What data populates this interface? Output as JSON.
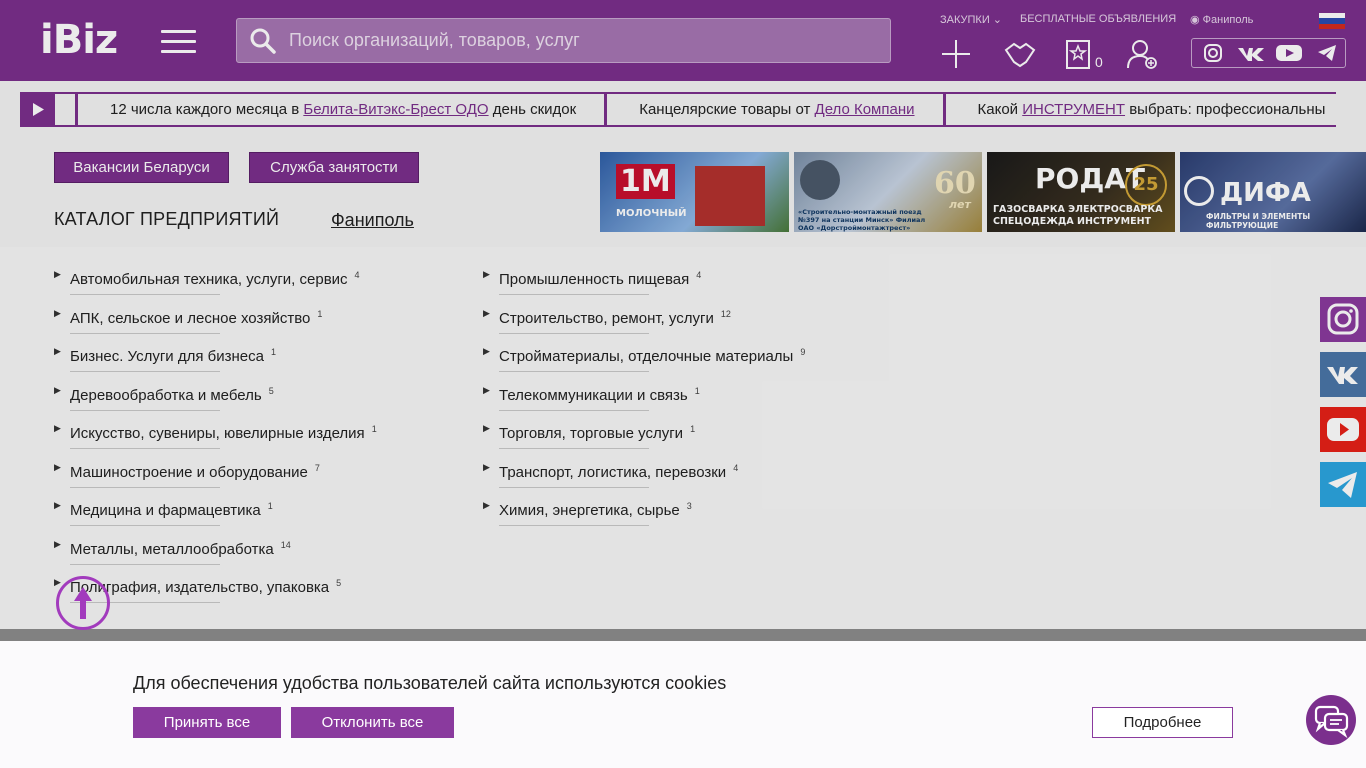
{
  "header": {
    "logo": "iBiz",
    "search_placeholder": "Поиск организаций, товаров, услуг",
    "links": {
      "zakupki": "ЗАКУПКИ",
      "free_ads": "БЕСПЛАТНЫЕ ОБЪЯВЛЕНИЯ",
      "location": "Фаниполь"
    },
    "favorites_count": "0",
    "icons": [
      "plus-icon",
      "handshake-icon",
      "star-icon",
      "user-add-icon"
    ],
    "social": [
      "instagram-icon",
      "vk-icon",
      "youtube-icon",
      "telegram-icon"
    ]
  },
  "ticker": [
    {
      "pre": "12 числа каждого месяца в ",
      "link": "Белита-Витэкс-Брест ОДО",
      "post": " день скидок"
    },
    {
      "pre": "Канцелярские товары от ",
      "link": "Дело Компани",
      "post": ""
    },
    {
      "pre": "Какой ",
      "link": "ИНСТРУМЕНТ",
      "post": " выбрать: профессиональны"
    }
  ],
  "buttons": {
    "vacancies": "Вакансии Беларуси",
    "employment": "Служба занятости"
  },
  "catalog": {
    "title": "КАТАЛОГ ПРЕДПРИЯТИЙ",
    "city": "Фаниполь",
    "col1": [
      {
        "label": "Автомобильная техника, услуги, сервис",
        "count": "4"
      },
      {
        "label": "АПК, сельское и лесное хозяйство",
        "count": "1"
      },
      {
        "label": "Бизнес. Услуги для бизнеса",
        "count": "1"
      },
      {
        "label": "Деревообработка и мебель",
        "count": "5"
      },
      {
        "label": "Искусство, сувениры, ювелирные изделия",
        "count": "1"
      },
      {
        "label": "Машиностроение и оборудование",
        "count": "7"
      },
      {
        "label": "Медицина и фармацевтика",
        "count": "1"
      },
      {
        "label": "Металлы, металлообработка",
        "count": "14"
      },
      {
        "label": "Полиграфия, издательство, упаковка",
        "count": "5"
      }
    ],
    "col2": [
      {
        "label": "Промышленность пищевая",
        "count": "4"
      },
      {
        "label": "Строительство, ремонт, услуги",
        "count": "12"
      },
      {
        "label": "Стройматериалы, отделочные материалы",
        "count": "9"
      },
      {
        "label": "Телекоммуникации и связь",
        "count": "1"
      },
      {
        "label": "Торговля, торговые услуги",
        "count": "1"
      },
      {
        "label": "Транспорт, логистика, перевозки",
        "count": "4"
      },
      {
        "label": "Химия, энергетика, сырье",
        "count": "3"
      }
    ]
  },
  "banners": {
    "b1": "1М",
    "b1_sub": "МОЛОЧНЫЙ",
    "b2": "60",
    "b2_sub": "«Строительно-монтажный поезд №397 на станции Минск» Филиал ОАО «Дорстроймонтажтрест»",
    "b2_sub2": "лет",
    "b3": "РОДАТ",
    "b3_sub": "ГАЗОСВАРКА  ЭЛЕКТРОСВАРКА",
    "b3_sub2": "СПЕЦОДЕЖДА  ИНСТРУМЕНТ",
    "b3_years": "25",
    "b4": "ДИФА",
    "b4_sub": "ФИЛЬТРЫ И ЭЛЕМЕНТЫ ФИЛЬТРУЮЩИЕ"
  },
  "cookie": {
    "message": "Для обеспечения удобства пользователей сайта используются cookies",
    "accept": "Принять все",
    "reject": "Отклонить все",
    "more": "Подробнее"
  },
  "colors": {
    "brand": "#7b2f8d",
    "accent": "#8a3a9e"
  }
}
